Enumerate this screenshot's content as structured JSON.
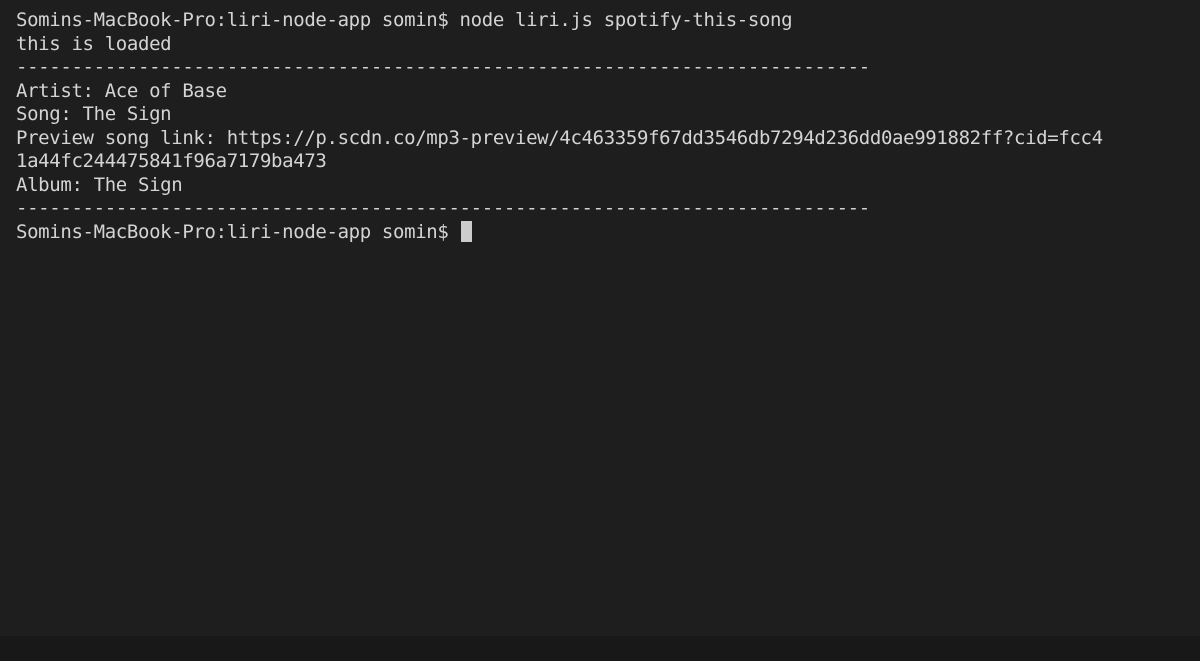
{
  "terminal": {
    "lines": [
      "Somins-MacBook-Pro:liri-node-app somin$ node liri.js spotify-this-song",
      "this is loaded",
      "-----------------------------------------------------------------------------",
      "Artist: Ace of Base",
      "Song: The Sign",
      "Preview song link: https://p.scdn.co/mp3-preview/4c463359f67dd3546db7294d236dd0ae991882ff?cid=fcc4",
      "1a44fc244475841f96a7179ba473",
      "Album: The Sign",
      "-----------------------------------------------------------------------------"
    ],
    "prompt": "Somins-MacBook-Pro:liri-node-app somin$ "
  },
  "colors": {
    "background": "#1e1e1e",
    "text": "#d4d4d4",
    "cursor": "#cccccc"
  }
}
